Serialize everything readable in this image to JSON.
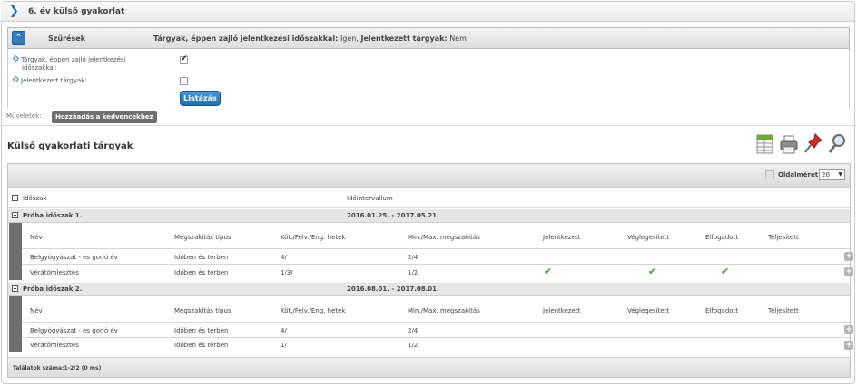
{
  "page": {
    "title": "6. év külső gyakorlat"
  },
  "filter": {
    "label": "Szűrések",
    "summary_key1": "Tárgyak, éppen zajló jelentkezési időszakkal:",
    "summary_val1": "Igen,",
    "summary_key2": "Jelentkezett tárgyak:",
    "summary_val2": "Nem",
    "row1_label_line1": "Tárgyak, éppen zajló jelentkezési",
    "row1_label_line2": "időszakkal:",
    "row1_checked": true,
    "row2_label": "Jelentkezett tárgyak:",
    "row2_checked": false,
    "list_button": "Listázás"
  },
  "operations": {
    "label": "Műveletek:",
    "add_favorite": "Hozzáadás a kedvencekhez"
  },
  "grid": {
    "title": "Külső gyakorlati tárgyak",
    "toolbar_icons": [
      "excel-export-icon",
      "print-icon",
      "pin-icon",
      "search-icon"
    ],
    "pager_label": "Oldalméret",
    "page_size": "20",
    "col_period": "Időszak",
    "col_interval": "Időintervallum",
    "columns": {
      "name": "Név",
      "type": "Megszakítás típus",
      "hours": "Köt./Felv./Eng. hetek",
      "minmax": "Min./Max. megszakítás",
      "applied": "Jelentkezett",
      "finalized": "Véglegesített",
      "accepted": "Elfogadott",
      "completed": "Teljesített"
    },
    "groups": [
      {
        "name": "Próba időszak 1.",
        "interval": "2016.01.25. - 2017.05.21.",
        "rows": [
          {
            "name": "Belgyógyászat - es gorló év",
            "type": "Időben és térben",
            "hours": "4/",
            "minmax": "2/4",
            "applied": false,
            "finalized": false,
            "accepted": false
          },
          {
            "name": "Vérátömlesztés",
            "type": "Időben és térben",
            "hours": "1/3/",
            "minmax": "1/2",
            "applied": true,
            "finalized": true,
            "accepted": true
          }
        ]
      },
      {
        "name": "Próba időszak 2.",
        "interval": "2016.08.01. - 2017.08.01.",
        "rows": [
          {
            "name": "Belgyógyászat - es gorló év",
            "type": "Időben és térben",
            "hours": "4/",
            "minmax": "2/4",
            "applied": false,
            "finalized": false,
            "accepted": false
          },
          {
            "name": "Vérátömlesztés",
            "type": "Időben és térben",
            "hours": "1/",
            "minmax": "1/2",
            "applied": false,
            "finalized": false,
            "accepted": false
          }
        ]
      }
    ],
    "footer": "Találatok száma:1-2/2 (0 ms)"
  },
  "colors": {
    "accent_blue": "#1f6eaf",
    "check_green": "#3aa32b"
  }
}
